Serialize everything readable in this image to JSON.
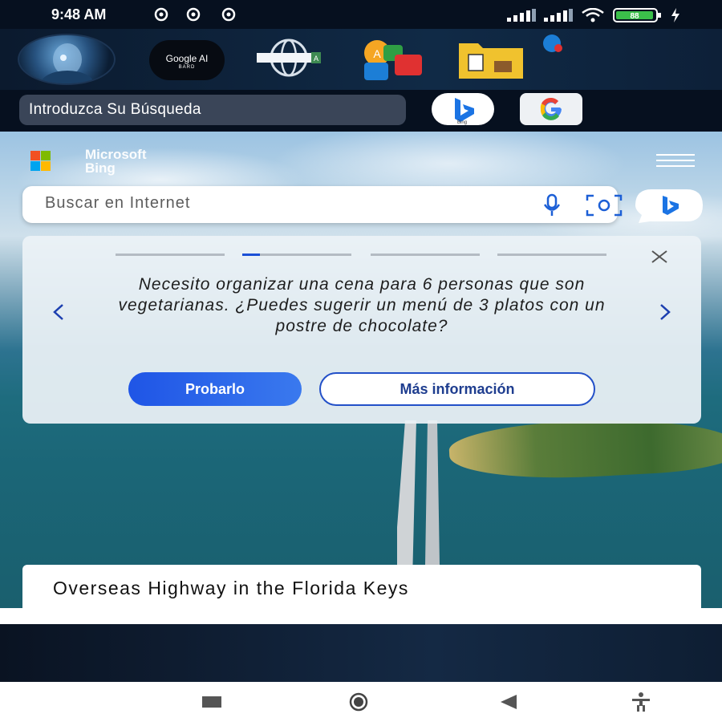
{
  "status_bar": {
    "time": "9:48 AM",
    "battery_level": "88"
  },
  "app_toolbar": {
    "icons": [
      "avatar-icon",
      "google-ai-bard-icon",
      "web-browser-icon",
      "translate-icon",
      "file-manager-icon"
    ],
    "bard_label": "Google AI",
    "bard_sublabel": "BARD",
    "web_label": "A"
  },
  "app_search": {
    "placeholder": "Introduzca Su Búsqueda",
    "bing_label": "Bing",
    "google_label": "G"
  },
  "bing": {
    "brand_line1": "Microsoft",
    "brand_line2": "Bing",
    "search_placeholder": "Buscar en Internet",
    "suggestion_card": {
      "prompt": "Necesito organizar una cena para 6 personas que son vegetarianas. ¿Puedes sugerir un menú de 3 platos con un postre de chocolate?",
      "slide_index": 2,
      "slide_count": 4,
      "try_label": "Probarlo",
      "more_label": "Más información"
    },
    "image_caption": "Overseas Highway in the Florida Keys"
  },
  "colors": {
    "accent_blue": "#1f55e6",
    "status_bg": "#06101f"
  }
}
